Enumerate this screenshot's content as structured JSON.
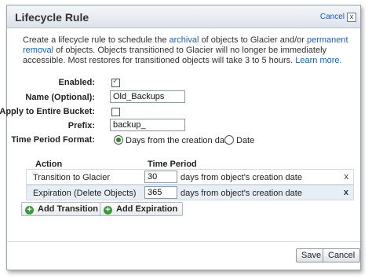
{
  "dialog": {
    "title": "Lifecycle Rule",
    "cancel_link": "Cancel",
    "close_glyph": "x"
  },
  "intro": {
    "t1": "Create a lifecycle rule to schedule the ",
    "link1": "archival",
    "t2": " of objects to Glacier and/or ",
    "link2": "permanent removal",
    "t3": " of objects. Objects transitioned to Glacier will no longer be immediately accessible. Most restores for transitioned objects will take 3 to 5 hours. ",
    "link3": "Learn more."
  },
  "form": {
    "enabled_label": "Enabled:",
    "enabled_checked": true,
    "name_label": "Name (Optional):",
    "name_value": "Old_Backups",
    "apply_label": "Apply to Entire Bucket:",
    "apply_checked": false,
    "prefix_label": "Prefix:",
    "prefix_value": "backup_",
    "time_format_label": "Time Period Format:",
    "time_format_options": [
      "Days from the creation date",
      "Date"
    ],
    "time_format_selected": "Days from the creation date"
  },
  "table": {
    "headers": [
      "Action",
      "Time Period"
    ],
    "rows": [
      {
        "action": "Transition to Glacier",
        "days": "30",
        "suffix": "days from object's creation date",
        "delete": "x"
      },
      {
        "action": "Expiration (Delete Objects)",
        "days": "365",
        "suffix": "days from object's creation date",
        "delete": "x"
      }
    ]
  },
  "buttons": {
    "add_transition": "Add Transition",
    "add_expiration": "Add Expiration",
    "save": "Save",
    "cancel": "Cancel"
  },
  "icons": {
    "add": "plus-circle-icon",
    "check": "check-icon"
  },
  "colors": {
    "link": "#1f5fae",
    "accent_green": "#3a9a3a",
    "row_alt": "#e8eef6"
  }
}
